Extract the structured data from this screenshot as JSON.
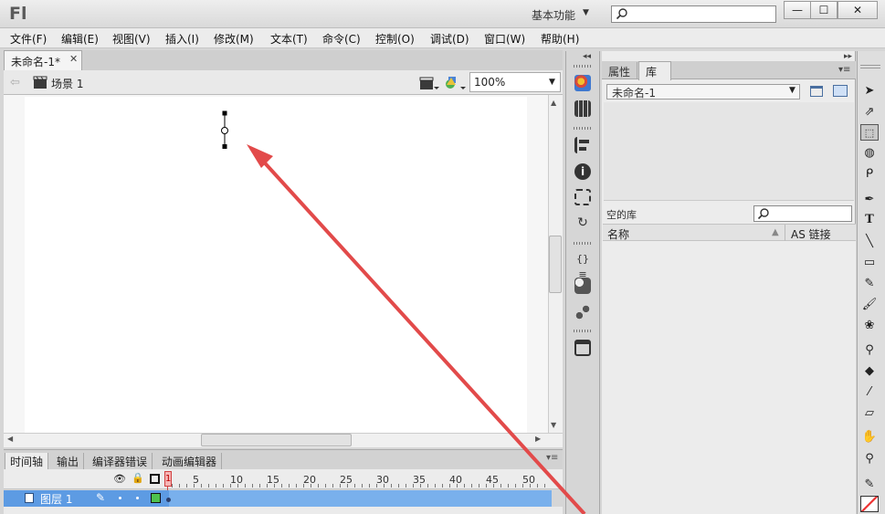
{
  "app": {
    "logo": "Fl",
    "workspace": "基本功能",
    "search_placeholder": ""
  },
  "window_controls": {
    "minimize": "—",
    "maximize": "☐",
    "close": "✕"
  },
  "menu": [
    "文件(F)",
    "编辑(E)",
    "视图(V)",
    "插入(I)",
    "修改(M)",
    "文本(T)",
    "命令(C)",
    "控制(O)",
    "调试(D)",
    "窗口(W)",
    "帮助(H)"
  ],
  "document": {
    "tab_title": "未命名-1*",
    "scene_label": "场景 1",
    "zoom": "100%"
  },
  "timeline": {
    "tabs": [
      "时间轴",
      "输出",
      "编译器错误",
      "动画编辑器"
    ],
    "frame_numbers": [
      "5",
      "10",
      "15",
      "20",
      "25",
      "30",
      "35",
      "40",
      "45",
      "50"
    ],
    "current_frame": "1",
    "layer_name": "图层 1"
  },
  "library_panel": {
    "tabs": [
      "属性",
      "库"
    ],
    "document_select": "未命名-1",
    "empty_label": "空的库",
    "col_name": "名称",
    "col_linkage": "AS 链接"
  },
  "tools": [
    "selection-tool",
    "subselection-tool",
    "free-transform-tool",
    "3d-rotation-tool",
    "lasso-tool",
    "pen-tool",
    "text-tool",
    "line-tool",
    "rectangle-tool",
    "pencil-tool",
    "brush-tool",
    "deco-tool",
    "bone-tool",
    "paint-bucket-tool",
    "eyedropper-tool",
    "eraser-tool",
    "hand-tool",
    "zoom-tool",
    "stroke-color",
    "fill-color"
  ],
  "colors": {
    "arrow": "#e24a4a",
    "layer_row": "#5d9be3",
    "playhead": "#d14141"
  }
}
